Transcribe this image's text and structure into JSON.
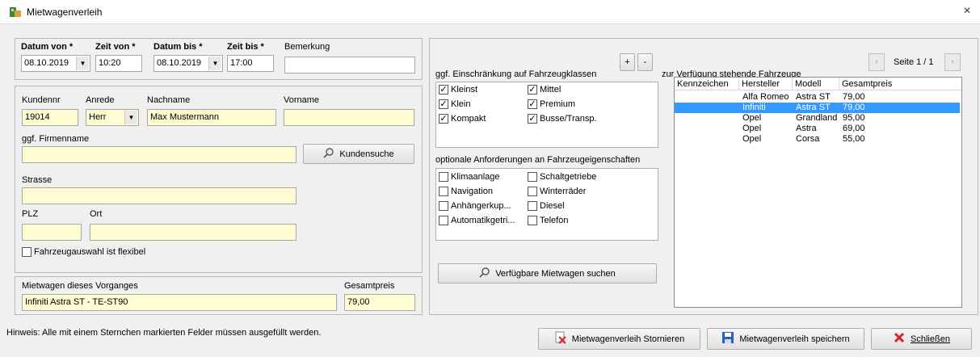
{
  "window": {
    "title": "Mietwagenverleih",
    "close": "×"
  },
  "date_group": {
    "datum_von_label": "Datum von *",
    "zeit_von_label": "Zeit von *",
    "datum_bis_label": "Datum bis *",
    "zeit_bis_label": "Zeit bis *",
    "bemerkung_label": "Bemerkung",
    "datum_von": "08.10.2019",
    "zeit_von": "10:20",
    "datum_bis": "08.10.2019",
    "zeit_bis": "17:00",
    "bemerkung": ""
  },
  "customer": {
    "kundennr_label": "Kundennr",
    "anrede_label": "Anrede",
    "nachname_label": "Nachname",
    "vorname_label": "Vorname",
    "kundennr": "19014",
    "anrede": "Herr",
    "nachname": "Max Mustermann",
    "vorname": "",
    "firmenname_label": "ggf. Firmenname",
    "firmenname": "",
    "kundensuche_label": "Kundensuche",
    "strasse_label": "Strasse",
    "strasse": "",
    "plz_label": "PLZ",
    "plz": "",
    "ort_label": "Ort",
    "ort": "",
    "flexibel_label": "Fahrzeugauswahl ist flexibel"
  },
  "vorgang": {
    "mietwagen_label": "Mietwagen dieses Vorganges",
    "mietwagen": "Infiniti Astra ST - TE-ST90",
    "gesamtpreis_label": "Gesamtpreis",
    "gesamtpreis": "79,00"
  },
  "classes": {
    "label": "ggf. Einschränkung auf Fahrzeugklassen",
    "plus": "+",
    "minus": "-",
    "items": [
      {
        "label": "Kleinst",
        "checked": true
      },
      {
        "label": "Mittel",
        "checked": true
      },
      {
        "label": "Klein",
        "checked": true
      },
      {
        "label": "Premium",
        "checked": true
      },
      {
        "label": "Kompakt",
        "checked": true
      },
      {
        "label": "Busse/Transp.",
        "checked": true
      }
    ]
  },
  "features": {
    "label": "optionale Anforderungen an Fahrzeugeigenschaften",
    "items": [
      {
        "label": "Klimaanlage"
      },
      {
        "label": "Schaltgetriebe"
      },
      {
        "label": "Navigation"
      },
      {
        "label": "Winterräder"
      },
      {
        "label": "Anhängerkup..."
      },
      {
        "label": "Diesel"
      },
      {
        "label": "Automatikgetri..."
      },
      {
        "label": "Telefon"
      }
    ],
    "search_button": "Verfügbare Mietwagen suchen"
  },
  "vehicles": {
    "label": "zur Verfügung stehende Fahrzeuge",
    "page_label": "Seite 1 / 1",
    "prev": "‹",
    "next": "›",
    "columns": [
      "Kennzeichen",
      "Hersteller",
      "Modell",
      "Gesamtpreis"
    ],
    "rows": [
      {
        "kennzeichen": "",
        "hersteller": "Alfa Romeo",
        "modell": "Astra ST",
        "preis": "79,00",
        "selected": false
      },
      {
        "kennzeichen": "",
        "hersteller": "Infiniti",
        "modell": "Astra ST",
        "preis": "79,00",
        "selected": true
      },
      {
        "kennzeichen": "",
        "hersteller": "Opel",
        "modell": "Grandland",
        "preis": "95,00",
        "selected": false
      },
      {
        "kennzeichen": "",
        "hersteller": "Opel",
        "modell": "Astra",
        "preis": "69,00",
        "selected": false
      },
      {
        "kennzeichen": "",
        "hersteller": "Opel",
        "modell": "Corsa",
        "preis": "55,00",
        "selected": false
      }
    ]
  },
  "footer": {
    "hint": "Hinweis: Alle mit einem Sternchen markierten Felder müssen ausgefüllt werden.",
    "storno_button": "Mietwagenverleih Stornieren",
    "save_button": "Mietwagenverleih speichern",
    "close_button": "Schließen"
  }
}
